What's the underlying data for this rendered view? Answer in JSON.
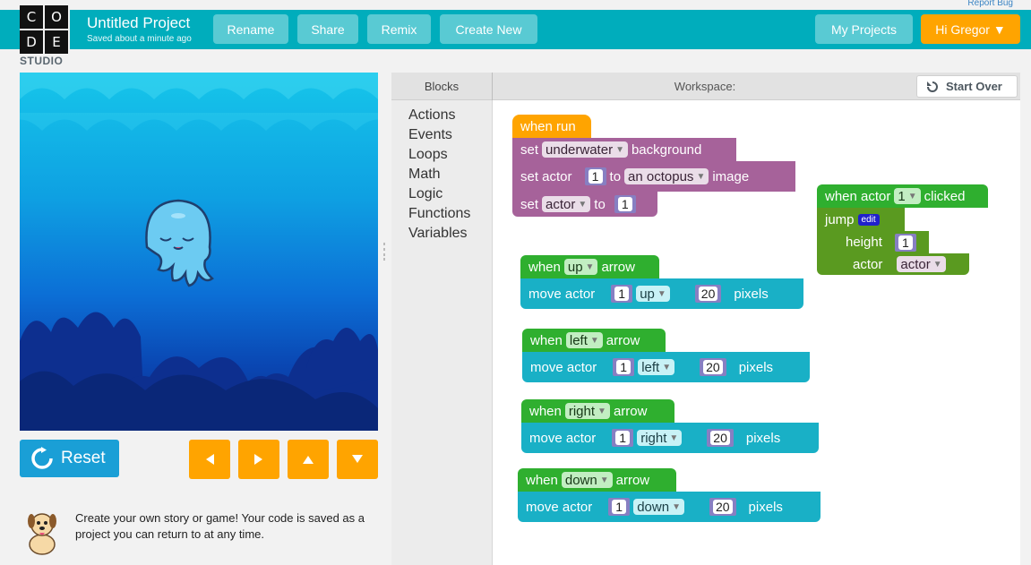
{
  "header": {
    "report_bug": "Report Bug",
    "logo_letters": [
      "C",
      "O",
      "D",
      "E"
    ],
    "logo_studio": "STUDIO",
    "project_title": "Untitled Project",
    "saved_status": "Saved about a minute ago",
    "rename": "Rename",
    "share": "Share",
    "remix": "Remix",
    "create_new": "Create New",
    "my_projects": "My Projects",
    "user_menu": "Hi Gregor ▼",
    "colors": {
      "bar": "#00adbc",
      "button": "#59cad3",
      "accent": "#ffa400"
    }
  },
  "stage": {
    "background": "underwater",
    "actor": "octopus"
  },
  "controls": {
    "reset": "Reset",
    "reset_icon": "refresh-icon",
    "arrows": [
      "left-arrow-icon",
      "right-arrow-icon",
      "up-arrow-icon",
      "down-arrow-icon"
    ]
  },
  "tip": {
    "text": "Create your own story or game! Your code is saved as a project you can return to at any time.",
    "icon": "dog-icon"
  },
  "workspace": {
    "blocks_header": "Blocks",
    "workspace_header": "Workspace:",
    "start_over": "Start Over",
    "categories": [
      "Actions",
      "Events",
      "Loops",
      "Math",
      "Logic",
      "Functions",
      "Variables"
    ]
  },
  "program": {
    "when_run": "when run",
    "set_bg": {
      "set": "set",
      "value": "underwater",
      "suffix": "background"
    },
    "set_actor": {
      "label": "set actor",
      "num": "1",
      "to": "to",
      "value": "an octopus",
      "suffix": "image"
    },
    "set_var": {
      "set": "set",
      "value": "actor",
      "to": "to",
      "num": "1"
    },
    "clicked": {
      "when": "when actor",
      "num": "1",
      "suffix": "clicked",
      "jump": "jump",
      "edit": "edit",
      "height": "height",
      "height_num": "1",
      "actor": "actor",
      "actor_value": "actor"
    },
    "handlers": [
      {
        "when": "when",
        "key": "up",
        "arrow": "arrow",
        "move": "move actor",
        "actor_num": "1",
        "dir": "up",
        "amount": "20",
        "unit": "pixels"
      },
      {
        "when": "when",
        "key": "left",
        "arrow": "arrow",
        "move": "move actor",
        "actor_num": "1",
        "dir": "left",
        "amount": "20",
        "unit": "pixels"
      },
      {
        "when": "when",
        "key": "right",
        "arrow": "arrow",
        "move": "move actor",
        "actor_num": "1",
        "dir": "right",
        "amount": "20",
        "unit": "pixels"
      },
      {
        "when": "when",
        "key": "down",
        "arrow": "arrow",
        "move": "move actor",
        "actor_num": "1",
        "dir": "down",
        "amount": "20",
        "unit": "pixels"
      }
    ]
  }
}
